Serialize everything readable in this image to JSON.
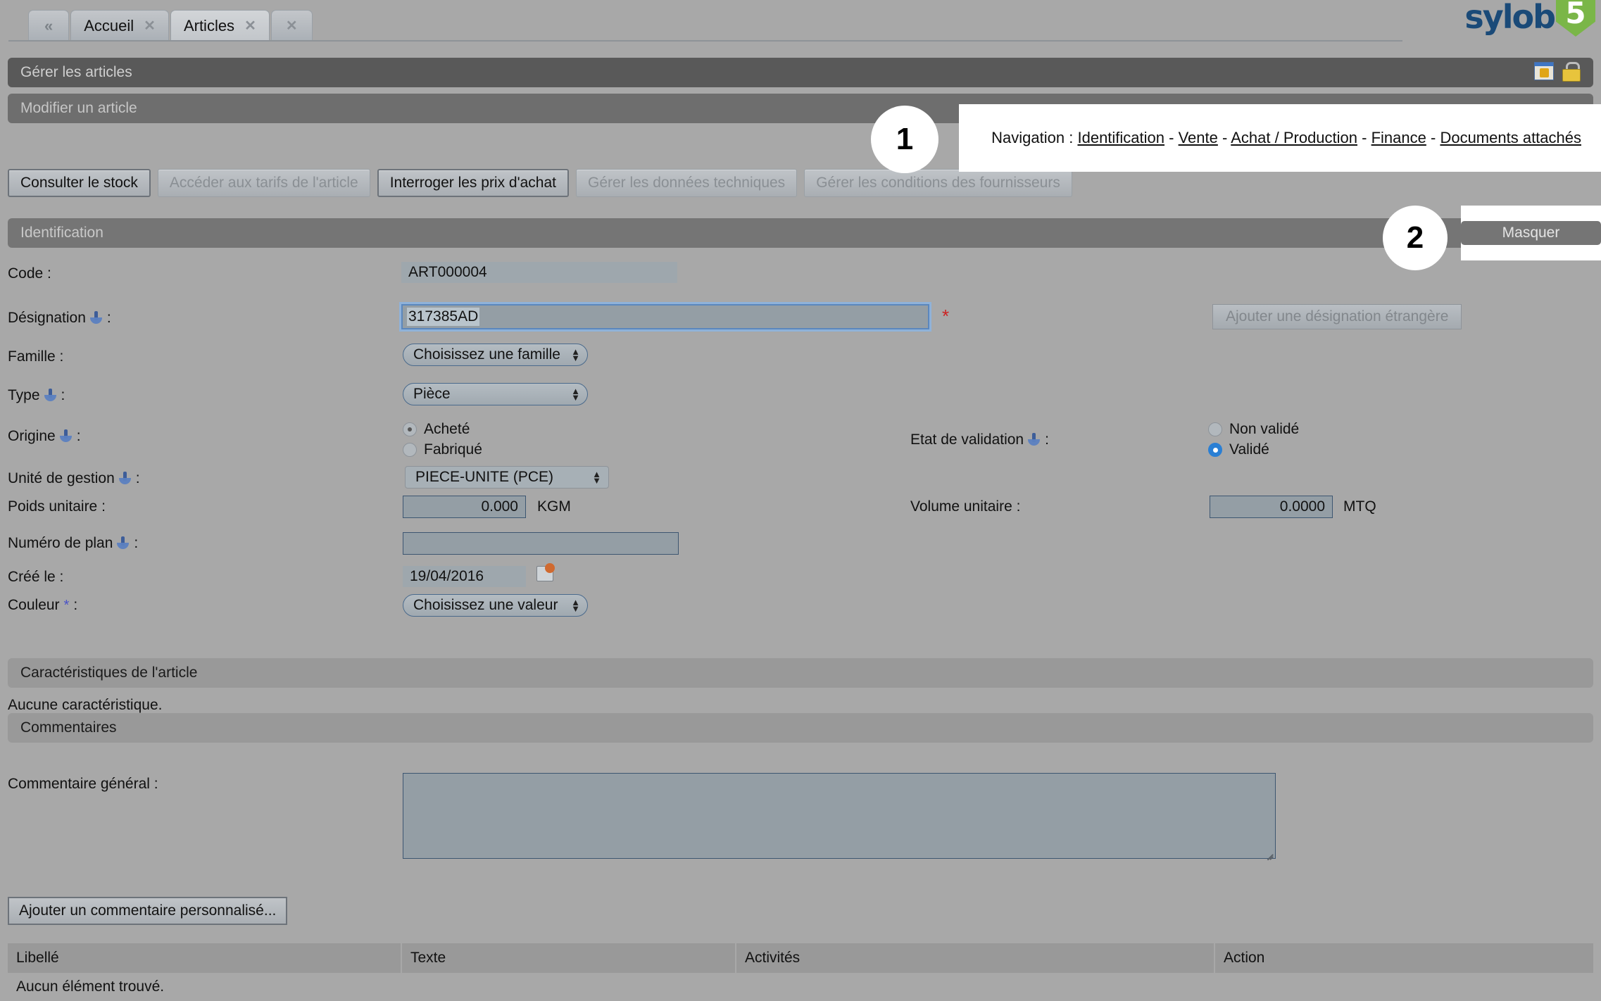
{
  "app": {
    "logo_text": "sylob",
    "logo_badge": "5"
  },
  "tabbar": {
    "back_label": "«",
    "tabs": [
      {
        "label": "Accueil",
        "close": "✕",
        "active": false
      },
      {
        "label": "Articles",
        "close": "✕",
        "active": true
      }
    ],
    "extra_tab_close": "✕"
  },
  "header": {
    "title": "Gérer les articles",
    "subtitle": "Modifier un article",
    "icon_window": "window-settings-icon",
    "icon_lock": "lock-icon"
  },
  "navigation": {
    "label": "Navigation :",
    "links": [
      "Identification",
      "Vente",
      "Achat / Production",
      "Finance",
      "Documents attachés"
    ],
    "separator": "-"
  },
  "action_buttons": [
    {
      "label": "Consulter le stock",
      "disabled": false,
      "outlined": true
    },
    {
      "label": "Accéder aux tarifs de l'article",
      "disabled": true,
      "outlined": false
    },
    {
      "label": "Interroger les prix d'achat",
      "disabled": false,
      "outlined": true
    },
    {
      "label": "Gérer les données techniques",
      "disabled": true,
      "outlined": false
    },
    {
      "label": "Gérer les conditions des fournisseurs",
      "disabled": true,
      "outlined": false
    }
  ],
  "sections": {
    "identification": "Identification",
    "caracteristiques": "Caractéristiques de l'article",
    "commentaires": "Commentaires",
    "masquer": "Masquer"
  },
  "form": {
    "code": {
      "label": "Code :",
      "value": "ART000004"
    },
    "designation": {
      "label": "Désignation",
      "suffix": ":",
      "value": "317385AD",
      "required_star": "*"
    },
    "add_foreign_designation": "Ajouter une désignation étrangère",
    "famille": {
      "label": "Famille :",
      "value": "Choisissez une famille"
    },
    "type": {
      "label": "Type",
      "suffix": ":",
      "value": "Pièce"
    },
    "origine": {
      "label": "Origine",
      "suffix": ":",
      "options": [
        {
          "label": "Acheté",
          "selected": true
        },
        {
          "label": "Fabriqué",
          "selected": false
        }
      ]
    },
    "etat_validation": {
      "label": "Etat de validation",
      "suffix": ":",
      "options": [
        {
          "label": "Non validé",
          "selected": false
        },
        {
          "label": "Validé",
          "selected": true
        }
      ]
    },
    "unite_gestion": {
      "label": "Unité de gestion",
      "suffix": ":",
      "value": "PIECE-UNITE (PCE)"
    },
    "poids_unitaire": {
      "label": "Poids unitaire :",
      "value": "0.000",
      "unit": "KGM"
    },
    "volume_unitaire": {
      "label": "Volume unitaire :",
      "value": "0.0000",
      "unit": "MTQ"
    },
    "numero_plan": {
      "label": "Numéro de plan",
      "suffix": ":",
      "value": ""
    },
    "cree_le": {
      "label": "Créé le :",
      "value": "19/04/2016",
      "icon": "calendar-icon"
    },
    "couleur": {
      "label": "Couleur",
      "star": "*",
      "suffix": ":",
      "value": "Choisissez une valeur"
    }
  },
  "caracteristiques": {
    "empty_text": "Aucune caractéristique."
  },
  "commentaires": {
    "general_label": "Commentaire général :",
    "general_value": "",
    "add_button": "Ajouter un commentaire personnalisé..."
  },
  "table": {
    "columns": [
      "Libellé",
      "Texte",
      "Activités",
      "Action"
    ],
    "empty_text": "Aucun élément trouvé."
  },
  "annotations": [
    {
      "number": "1"
    },
    {
      "number": "2"
    }
  ],
  "colors": {
    "page_bg": "#a8a8a8",
    "title_bar": "#595959",
    "sub_bar": "#6e6e6e",
    "section_bar": "#757575",
    "accent_blue": "#2a7fd4",
    "logo_blue": "#1a4a78",
    "logo_green": "#7ab648",
    "required_red": "#cc2222",
    "custom_star_blue": "#4a52c8"
  }
}
